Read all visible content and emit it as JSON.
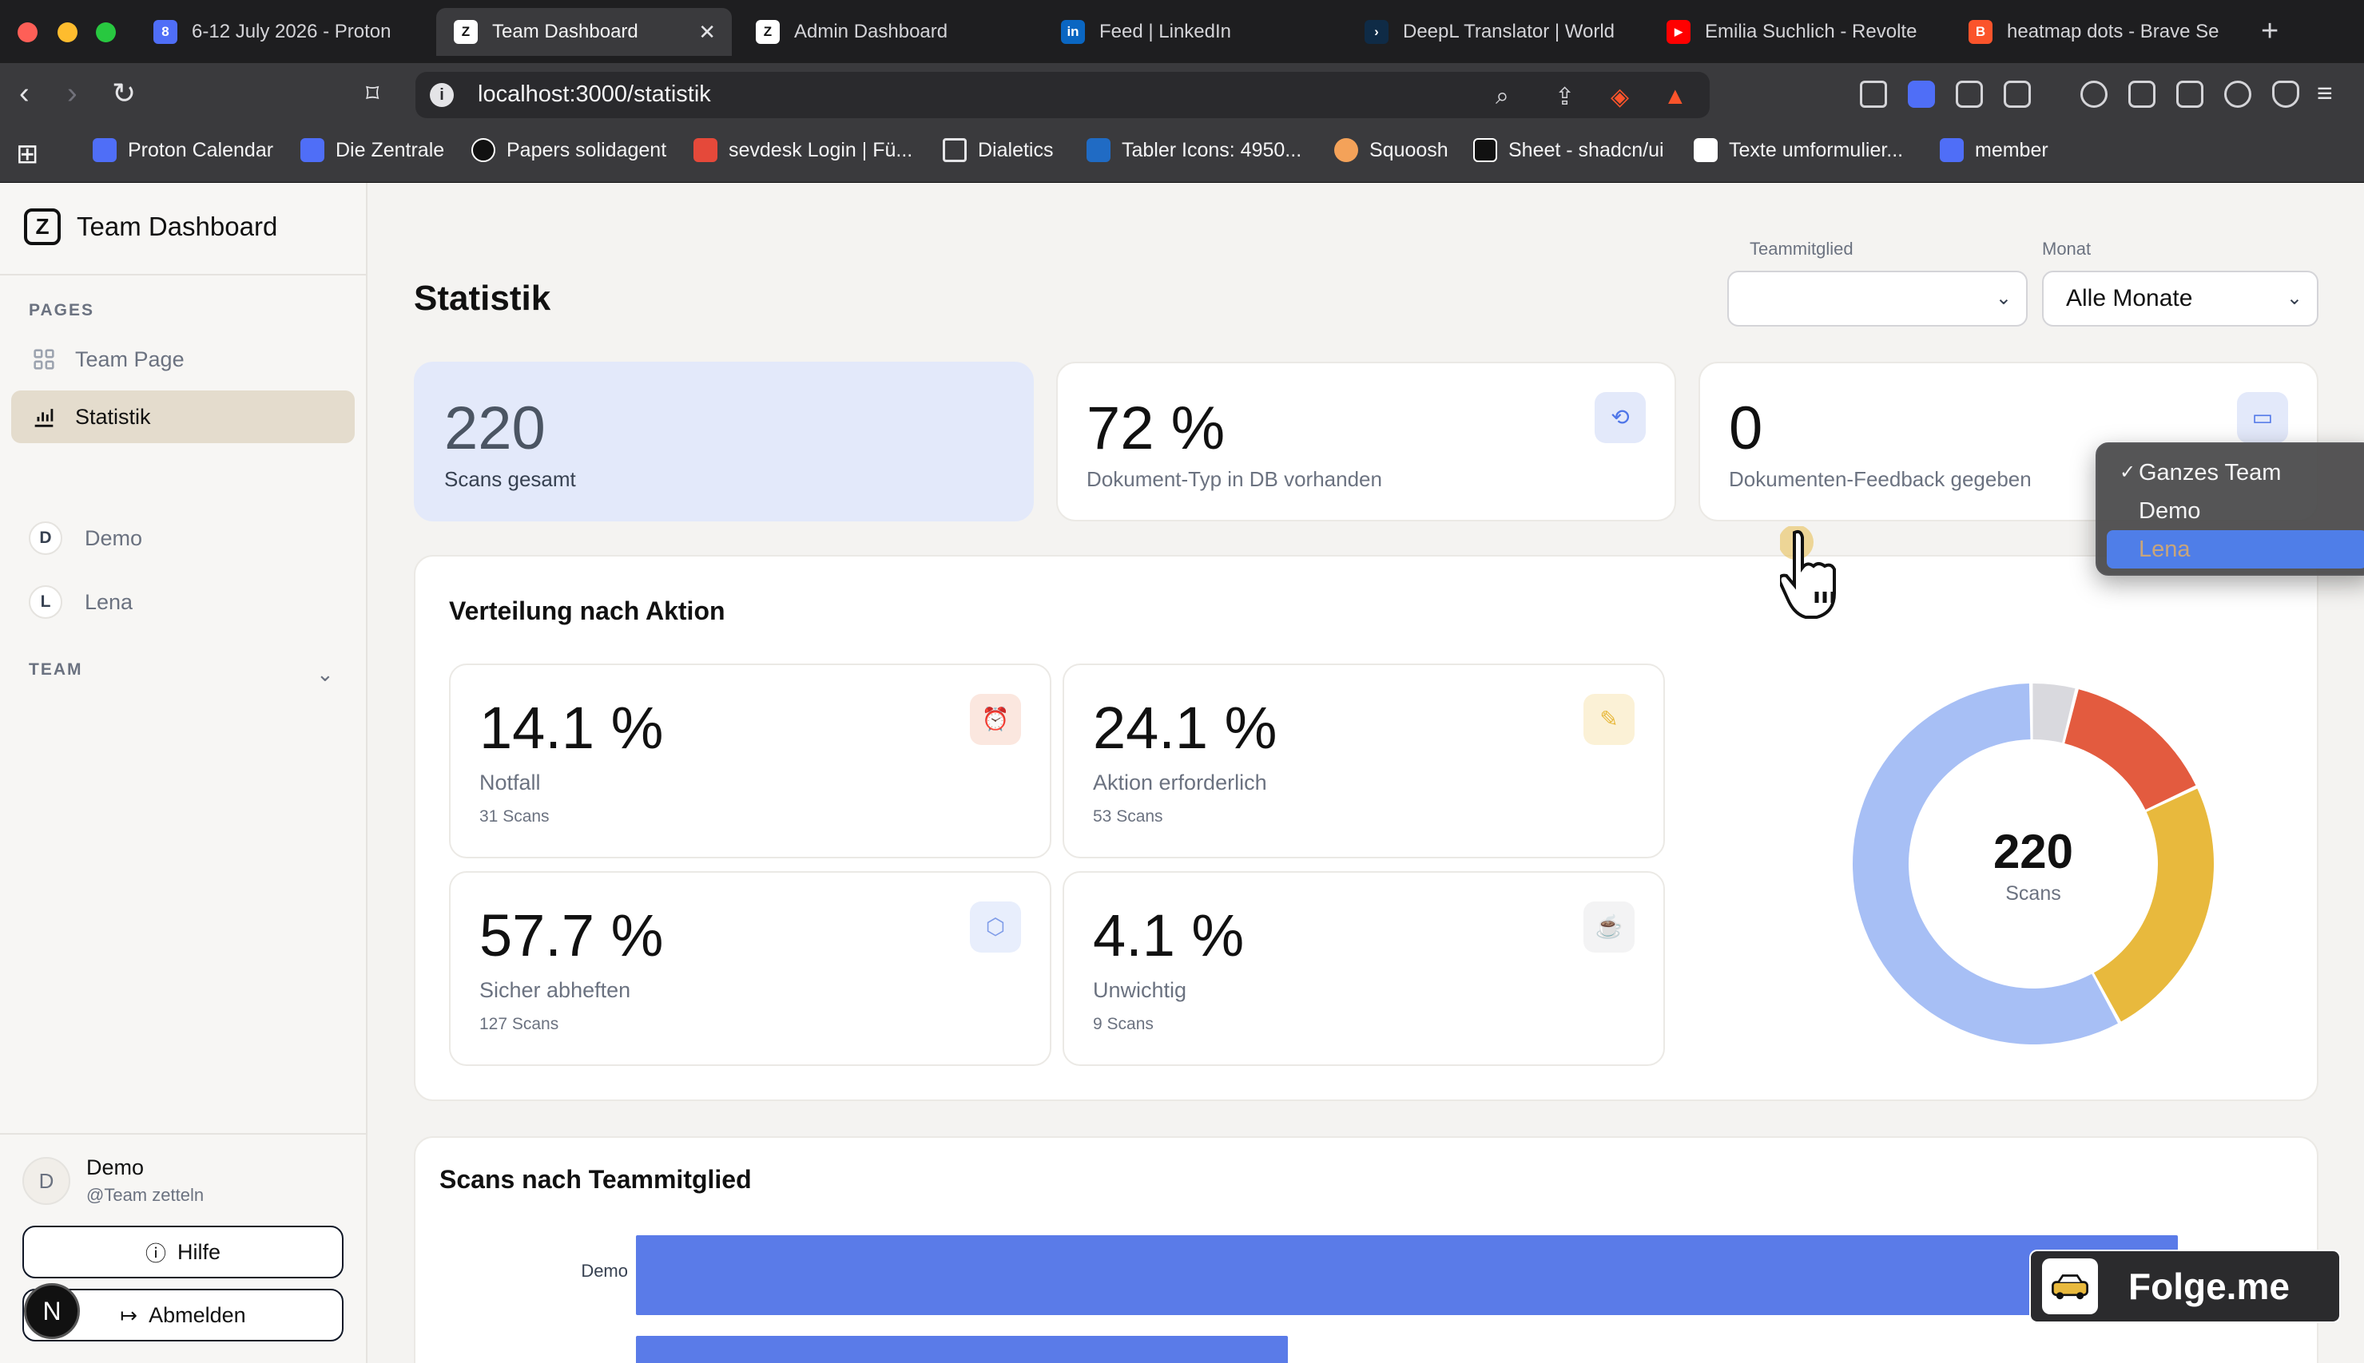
{
  "browser": {
    "tabs": [
      {
        "label": "6-12 July 2026 - Proton",
        "favicon": "calendar-icon",
        "color": "#4f6ef7",
        "badge": "8"
      },
      {
        "label": "Team Dashboard",
        "favicon": "z-logo-icon",
        "color": "#ffffff",
        "badge": "Z",
        "active": true
      },
      {
        "label": "Admin Dashboard",
        "favicon": "z-logo-icon",
        "color": "#ffffff",
        "badge": "Z"
      },
      {
        "label": "Feed | LinkedIn",
        "favicon": "linkedin-icon",
        "color": "#0a66c2",
        "badge": "in"
      },
      {
        "label": "DeepL Translator | World",
        "favicon": "deepl-icon",
        "color": "#0f2b46",
        "badge": "›"
      },
      {
        "label": "Emilia Suchlich - Revolte",
        "favicon": "youtube-icon",
        "color": "#ff0000",
        "badge": "▶"
      },
      {
        "label": "heatmap dots - Brave Se",
        "favicon": "brave-icon",
        "color": "#fb542b",
        "badge": "B"
      }
    ],
    "url": "localhost:3000/statistik",
    "bookmarks": [
      {
        "label": "Proton Calendar",
        "color": "#4f6ef7"
      },
      {
        "label": "Die Zentrale",
        "color": "#4f6ef7"
      },
      {
        "label": "Papers solidagent",
        "color": "#111111"
      },
      {
        "label": "sevdesk Login | Fü...",
        "color": "#e5493a"
      },
      {
        "label": "Dialetics",
        "color": "transparent"
      },
      {
        "label": "Tabler Icons: 4950...",
        "color": "#206bc4"
      },
      {
        "label": "Squoosh",
        "color": "#f4a259"
      },
      {
        "label": "Sheet - shadcn/ui",
        "color": "#111111"
      },
      {
        "label": "Texte umformulier...",
        "color": "#ffffff"
      },
      {
        "label": "member",
        "color": "#4f6ef7"
      }
    ]
  },
  "sidebar": {
    "brand": "Team Dashboard",
    "pages_heading": "PAGES",
    "pages": [
      {
        "label": "Team Page",
        "icon": "layout-grid-icon"
      },
      {
        "label": "Statistik",
        "icon": "bar-chart-icon",
        "active": true
      }
    ],
    "team_heading": "TEAM",
    "members": [
      {
        "initial": "D",
        "name": "Demo"
      },
      {
        "initial": "L",
        "name": "Lena"
      }
    ],
    "user": {
      "initial": "D",
      "name": "Demo",
      "handle": "@Team zetteln"
    },
    "help_label": "Hilfe",
    "logout_label": "Abmelden",
    "n_badge": "N"
  },
  "main": {
    "title": "Statistik",
    "filters": {
      "member_label": "Teammitglied",
      "month_label": "Monat",
      "month_value": "Alle Monate"
    },
    "dropdown": {
      "options": [
        "Ganzes Team",
        "Demo",
        "Lena"
      ],
      "selected": "Ganzes Team",
      "highlighted": "Lena"
    },
    "stats": [
      {
        "value": "220",
        "label": "Scans gesamt"
      },
      {
        "value": "72 %",
        "label": "Dokument-Typ in DB vorhanden",
        "icon": "file-refresh-icon"
      },
      {
        "value": "0",
        "label": "Dokumenten-Feedback gegeben",
        "icon": "message-icon"
      }
    ],
    "distribution": {
      "title": "Verteilung nach Aktion",
      "items": [
        {
          "pct": "14.1 %",
          "label": "Notfall",
          "count": "31 Scans",
          "icon": "alarm-icon",
          "color": "#e35b3f"
        },
        {
          "pct": "24.1 %",
          "label": "Aktion erforderlich",
          "count": "53 Scans",
          "icon": "pencil-icon",
          "color": "#e8b93d"
        },
        {
          "pct": "57.7 %",
          "label": "Sicher abheften",
          "count": "127 Scans",
          "icon": "box-icon",
          "color": "#a7bff5"
        },
        {
          "pct": "4.1 %",
          "label": "Unwichtig",
          "count": "9 Scans",
          "icon": "coffee-icon",
          "color": "#d9d9de"
        }
      ],
      "total_value": "220",
      "total_label": "Scans"
    },
    "by_member": {
      "title": "Scans nach Teammitglied",
      "labels": [
        "Demo"
      ]
    }
  },
  "chart_data": [
    {
      "type": "pie",
      "categories": [
        "Notfall",
        "Aktion erforderlich",
        "Sicher abheften",
        "Unwichtig"
      ],
      "values": [
        31,
        53,
        127,
        9
      ],
      "colors": [
        "#e35b3f",
        "#e8b93d",
        "#a7bff5",
        "#d9d9de"
      ],
      "title": ""
    },
    {
      "type": "bar",
      "categories": [
        "Demo",
        ""
      ],
      "values": [
        220,
        93
      ],
      "title": "Scans nach Teammitglied"
    }
  ],
  "overlay": {
    "brand": "Folge.me"
  }
}
